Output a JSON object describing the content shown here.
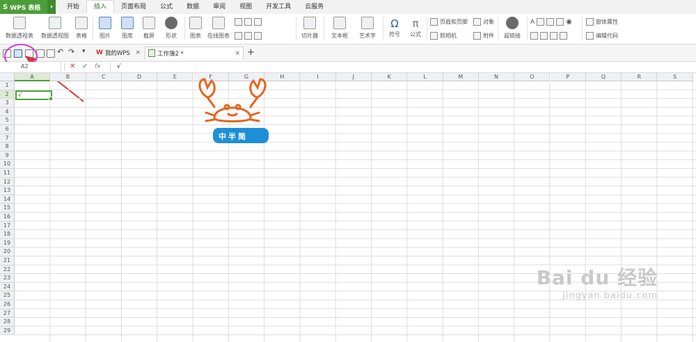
{
  "app": {
    "name": "WPS 表格",
    "brand_color": "#4c9e39"
  },
  "menu_tabs": [
    "开始",
    "插入",
    "页面布局",
    "公式",
    "数据",
    "审阅",
    "视图",
    "开发工具",
    "云服务"
  ],
  "active_menu_tab": "插入",
  "ribbon": {
    "pivot_table": "数据透视表",
    "pivot_chart": "数据透视图",
    "table": "表格",
    "picture": "图片",
    "gallery": "图库",
    "screenshot": "截屏",
    "shapes": "形状",
    "chart": "图表",
    "online_chart": "在线图表",
    "slicer": "切片器",
    "textbox": "文本框",
    "wordart": "艺术字",
    "symbol": "符号",
    "formula": "公式",
    "header_footer": "页眉和页脚",
    "object": "对象",
    "camera": "照相机",
    "attachment": "附件",
    "hyperlink": "超链接",
    "form_properties": "窗体属性",
    "edit_code": "编辑代码"
  },
  "doc_tabs": [
    {
      "label": "我的WPS"
    },
    {
      "label": "工作簿2 *"
    }
  ],
  "formula_bar": {
    "name_box": "A2",
    "content": "√"
  },
  "columns": [
    "A",
    "B",
    "C",
    "D",
    "E",
    "F",
    "G",
    "H",
    "I",
    "J",
    "K",
    "L",
    "M",
    "N",
    "O",
    "P",
    "Q",
    "R",
    "S"
  ],
  "rows": [
    "1",
    "2",
    "3",
    "4",
    "5",
    "6",
    "7",
    "8",
    "9",
    "10",
    "11",
    "12",
    "13",
    "14",
    "15",
    "16",
    "17",
    "18",
    "19",
    "20",
    "21",
    "22",
    "23",
    "24",
    "25",
    "26",
    "27",
    "28",
    "29"
  ],
  "active_cell": {
    "ref": "A2",
    "value": "√"
  },
  "overlay": {
    "badge_text": "中半简",
    "crab_color": "#e8641f",
    "badge_color": "#1e8fd6"
  },
  "watermark": {
    "brand": "Bai du 经验",
    "url": "jingyan.baidu.com"
  }
}
